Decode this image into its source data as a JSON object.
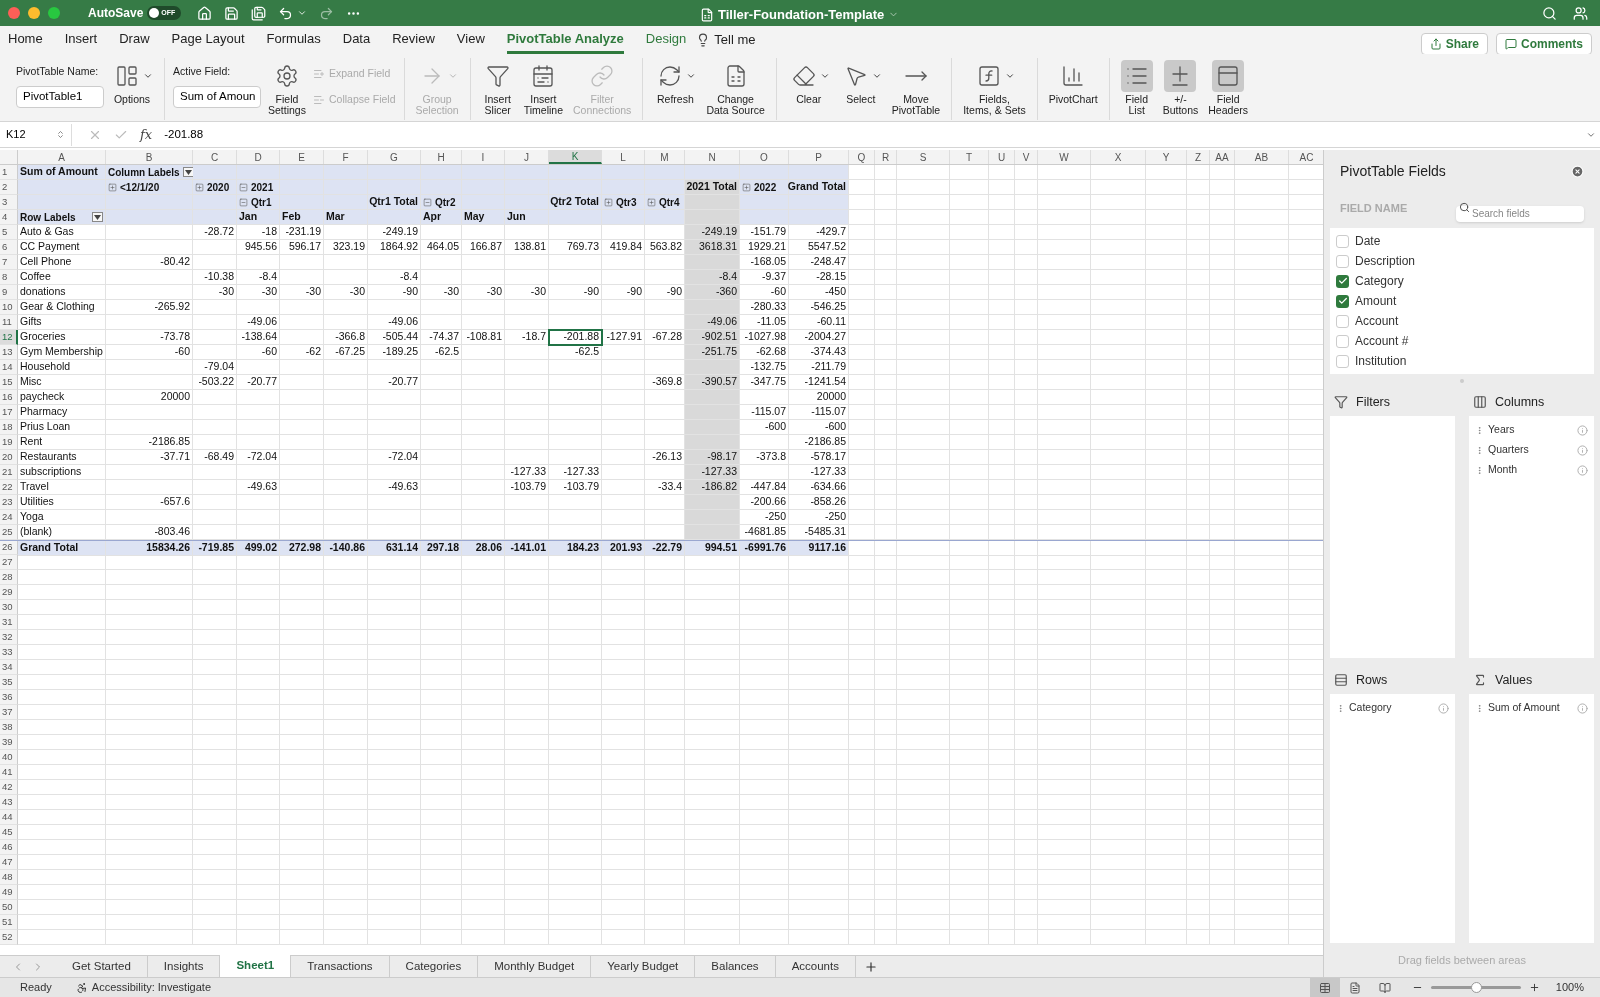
{
  "title_bar": {
    "autosave": {
      "label": "AutoSave",
      "on": false,
      "state_text": "OFF"
    },
    "title": "Tiller-Foundation-Template"
  },
  "tabs": [
    {
      "label": "Home",
      "selected": false,
      "kind": "standard"
    },
    {
      "label": "Insert",
      "selected": false,
      "kind": "standard"
    },
    {
      "label": "Draw",
      "selected": false,
      "kind": "standard"
    },
    {
      "label": "Page Layout",
      "selected": false,
      "kind": "standard"
    },
    {
      "label": "Formulas",
      "selected": false,
      "kind": "standard"
    },
    {
      "label": "Data",
      "selected": false,
      "kind": "standard"
    },
    {
      "label": "Review",
      "selected": false,
      "kind": "standard"
    },
    {
      "label": "View",
      "selected": false,
      "kind": "standard"
    },
    {
      "label": "PivotTable Analyze",
      "selected": true,
      "kind": "contextual"
    },
    {
      "label": "Design",
      "selected": false,
      "kind": "contextual"
    },
    {
      "label": "Tell me",
      "selected": false,
      "kind": "search"
    }
  ],
  "share_buttons": [
    "Share",
    "Comments"
  ],
  "ribbon": {
    "groups": [
      {
        "items": [
          {
            "kind": "name_field",
            "label": "PivotTable Name:",
            "value": "PivotTable1"
          },
          {
            "kind": "large",
            "label": "Options",
            "dropdown": true,
            "disabled": false,
            "pressed": false
          }
        ]
      },
      {
        "items": [
          {
            "kind": "name_field",
            "label": "Active Field:",
            "value": "Sum of Amoun"
          },
          {
            "kind": "large",
            "label": "Field\nSettings",
            "dropdown": false,
            "disabled": false,
            "pressed": false
          },
          {
            "kind": "small_stack",
            "buttons": [
              {
                "label": "Expand Field",
                "disabled": true
              },
              {
                "label": "Collapse Field",
                "disabled": true
              }
            ]
          }
        ]
      },
      {
        "items": [
          {
            "kind": "large",
            "label": "Group\nSelection",
            "dropdown": true,
            "disabled": true,
            "pressed": false
          }
        ]
      },
      {
        "items": [
          {
            "kind": "large",
            "label": "Insert\nSlicer",
            "dropdown": false,
            "disabled": false,
            "pressed": false
          },
          {
            "kind": "large",
            "label": "Insert\nTimeline",
            "dropdown": false,
            "disabled": false,
            "pressed": false
          },
          {
            "kind": "large",
            "label": "Filter\nConnections",
            "dropdown": false,
            "disabled": true,
            "pressed": false
          }
        ]
      },
      {
        "items": [
          {
            "kind": "large",
            "label": "Refresh",
            "dropdown": true,
            "disabled": false,
            "pressed": false
          },
          {
            "kind": "large",
            "label": "Change\nData Source",
            "dropdown": false,
            "disabled": false,
            "pressed": false
          }
        ]
      },
      {
        "items": [
          {
            "kind": "large",
            "label": "Clear",
            "dropdown": true,
            "disabled": false,
            "pressed": false
          },
          {
            "kind": "large",
            "label": "Select",
            "dropdown": true,
            "disabled": false,
            "pressed": false
          },
          {
            "kind": "large",
            "label": "Move\nPivotTable",
            "dropdown": false,
            "disabled": false,
            "pressed": false
          }
        ]
      },
      {
        "items": [
          {
            "kind": "large",
            "label": "Fields,\nItems, & Sets",
            "dropdown": true,
            "disabled": false,
            "pressed": false
          }
        ]
      },
      {
        "items": [
          {
            "kind": "large",
            "label": "PivotChart",
            "dropdown": false,
            "disabled": false,
            "pressed": false
          }
        ]
      },
      {
        "items": [
          {
            "kind": "large",
            "label": "Field\nList",
            "dropdown": false,
            "disabled": false,
            "pressed": true
          },
          {
            "kind": "large",
            "label": "+/-\nButtons",
            "dropdown": false,
            "disabled": false,
            "pressed": true
          },
          {
            "kind": "large",
            "label": "Field\nHeaders",
            "dropdown": false,
            "disabled": false,
            "pressed": true
          }
        ]
      }
    ]
  },
  "formula_bar": {
    "name_box": "K12",
    "function_label": "fx",
    "formula": "-201.88"
  },
  "sheet": {
    "columns": [
      {
        "label": "A",
        "selected": false
      },
      {
        "label": "B",
        "selected": false
      },
      {
        "label": "C",
        "selected": false
      },
      {
        "label": "D",
        "selected": false
      },
      {
        "label": "E",
        "selected": false
      },
      {
        "label": "F",
        "selected": false
      },
      {
        "label": "G",
        "selected": false
      },
      {
        "label": "H",
        "selected": false
      },
      {
        "label": "I",
        "selected": false
      },
      {
        "label": "J",
        "selected": false
      },
      {
        "label": "K",
        "selected": true
      },
      {
        "label": "L",
        "selected": false
      },
      {
        "label": "M",
        "selected": false
      },
      {
        "label": "N",
        "selected": false
      },
      {
        "label": "O",
        "selected": false
      },
      {
        "label": "P",
        "selected": false
      },
      {
        "label": "Q",
        "selected": false
      },
      {
        "label": "R",
        "selected": false
      },
      {
        "label": "S",
        "selected": false
      },
      {
        "label": "T",
        "selected": false
      },
      {
        "label": "U",
        "selected": false
      },
      {
        "label": "V",
        "selected": false
      },
      {
        "label": "W",
        "selected": false
      },
      {
        "label": "X",
        "selected": false
      },
      {
        "label": "Y",
        "selected": false
      },
      {
        "label": "Z",
        "selected": false
      },
      {
        "label": "AA",
        "selected": false
      },
      {
        "label": "AB",
        "selected": false
      },
      {
        "label": "AC",
        "selected": false
      }
    ],
    "rows": [
      {
        "label": "1",
        "selected": false
      },
      {
        "label": "2",
        "selected": false
      },
      {
        "label": "3",
        "selected": false
      },
      {
        "label": "4",
        "selected": false
      },
      {
        "label": "5",
        "selected": false
      },
      {
        "label": "6",
        "selected": false
      },
      {
        "label": "7",
        "selected": false
      },
      {
        "label": "8",
        "selected": false
      },
      {
        "label": "9",
        "selected": false
      },
      {
        "label": "10",
        "selected": false
      },
      {
        "label": "11",
        "selected": false
      },
      {
        "label": "12",
        "selected": true
      },
      {
        "label": "13",
        "selected": false
      },
      {
        "label": "14",
        "selected": false
      },
      {
        "label": "15",
        "selected": false
      },
      {
        "label": "16",
        "selected": false
      },
      {
        "label": "17",
        "selected": false
      },
      {
        "label": "18",
        "selected": false
      },
      {
        "label": "19",
        "selected": false
      },
      {
        "label": "20",
        "selected": false
      },
      {
        "label": "21",
        "selected": false
      },
      {
        "label": "22",
        "selected": false
      },
      {
        "label": "23",
        "selected": false
      },
      {
        "label": "24",
        "selected": false
      },
      {
        "label": "25",
        "selected": false
      },
      {
        "label": "26",
        "selected": false
      },
      {
        "label": "27",
        "selected": false
      },
      {
        "label": "28",
        "selected": false
      },
      {
        "label": "29",
        "selected": false
      },
      {
        "label": "30",
        "selected": false
      },
      {
        "label": "31",
        "selected": false
      },
      {
        "label": "32",
        "selected": false
      },
      {
        "label": "33",
        "selected": false
      },
      {
        "label": "34",
        "selected": false
      },
      {
        "label": "35",
        "selected": false
      },
      {
        "label": "36",
        "selected": false
      },
      {
        "label": "37",
        "selected": false
      },
      {
        "label": "38",
        "selected": false
      },
      {
        "label": "39",
        "selected": false
      },
      {
        "label": "40",
        "selected": false
      },
      {
        "label": "41",
        "selected": false
      },
      {
        "label": "42",
        "selected": false
      },
      {
        "label": "43",
        "selected": false
      },
      {
        "label": "44",
        "selected": false
      },
      {
        "label": "45",
        "selected": false
      },
      {
        "label": "46",
        "selected": false
      },
      {
        "label": "47",
        "selected": false
      },
      {
        "label": "48",
        "selected": false
      },
      {
        "label": "49",
        "selected": false
      },
      {
        "label": "50",
        "selected": false
      },
      {
        "label": "51",
        "selected": false
      },
      {
        "label": "52",
        "selected": false
      }
    ],
    "pivot": {
      "header_rows": [
        {
          "a": {
            "text": "Sum of Amount",
            "kind": "label"
          },
          "b": {
            "text": "Column Labels",
            "kind": "label",
            "filter": true
          }
        },
        {
          "b": {
            "text": "<12/1/20",
            "kind": "label",
            "expanded": false
          },
          "c": {
            "text": "2020",
            "kind": "label",
            "expanded": false
          },
          "d": {
            "text": "2021",
            "kind": "label",
            "expanded": true
          },
          "n": {
            "text": "2021 Total",
            "kind": "total"
          },
          "o": {
            "text": "2022",
            "kind": "label",
            "expanded": false
          },
          "p": {
            "text": "Grand Total",
            "kind": "total"
          }
        },
        {
          "d": {
            "text": "Qtr1",
            "kind": "label",
            "expanded": true
          },
          "g": {
            "text": "Qtr1 Total",
            "kind": "total"
          },
          "h": {
            "text": "Qtr2",
            "kind": "label",
            "expanded": true
          },
          "k": {
            "text": "Qtr2 Total",
            "kind": "total"
          },
          "l": {
            "text": "Qtr3",
            "kind": "label",
            "expanded": false
          },
          "m": {
            "text": "Qtr4",
            "kind": "label",
            "expanded": false
          }
        },
        {
          "a": {
            "text": "Row Labels",
            "kind": "label",
            "filter": true
          },
          "d": {
            "text": "Jan",
            "kind": "label"
          },
          "e": {
            "text": "Feb",
            "kind": "label"
          },
          "f": {
            "text": "Mar",
            "kind": "label"
          },
          "h": {
            "text": "Apr",
            "kind": "label"
          },
          "i": {
            "text": "May",
            "kind": "label"
          },
          "j": {
            "text": "Jun",
            "kind": "label"
          }
        }
      ],
      "body_rows": [
        {
          "label": "Auto & Gas",
          "values": {
            "c": "-28.72",
            "d": "-18",
            "e": "-231.19",
            "g": "-249.19",
            "n": "-249.19",
            "o": "-151.79",
            "p": "-429.7"
          }
        },
        {
          "label": "CC Payment",
          "values": {
            "d": "945.56",
            "e": "596.17",
            "f": "323.19",
            "g": "1864.92",
            "h": "464.05",
            "i": "166.87",
            "j": "138.81",
            "k": "769.73",
            "l": "419.84",
            "m": "563.82",
            "n": "3618.31",
            "o": "1929.21",
            "p": "5547.52"
          }
        },
        {
          "label": "Cell Phone",
          "values": {
            "b": "-80.42",
            "o": "-168.05",
            "p": "-248.47"
          }
        },
        {
          "label": "Coffee",
          "values": {
            "c": "-10.38",
            "d": "-8.4",
            "g": "-8.4",
            "n": "-8.4",
            "o": "-9.37",
            "p": "-28.15"
          }
        },
        {
          "label": "donations",
          "values": {
            "c": "-30",
            "d": "-30",
            "e": "-30",
            "f": "-30",
            "g": "-90",
            "h": "-30",
            "i": "-30",
            "j": "-30",
            "k": "-90",
            "l": "-90",
            "m": "-90",
            "n": "-360",
            "o": "-60",
            "p": "-450"
          }
        },
        {
          "label": "Gear & Clothing",
          "values": {
            "b": "-265.92",
            "o": "-280.33",
            "p": "-546.25"
          }
        },
        {
          "label": "Gifts",
          "values": {
            "d": "-49.06",
            "g": "-49.06",
            "n": "-49.06",
            "o": "-11.05",
            "p": "-60.11"
          }
        },
        {
          "label": "Groceries",
          "values": {
            "b": "-73.78",
            "d": "-138.64",
            "f": "-366.8",
            "g": "-505.44",
            "h": "-74.37",
            "i": "-108.81",
            "j": "-18.7",
            "k": "-201.88",
            "l": "-127.91",
            "m": "-67.28",
            "n": "-902.51",
            "o": "-1027.98",
            "p": "-2004.27"
          }
        },
        {
          "label": "Gym Membership",
          "values": {
            "b": "-60",
            "d": "-60",
            "e": "-62",
            "f": "-67.25",
            "g": "-189.25",
            "h": "-62.5",
            "k": "-62.5",
            "n": "-251.75",
            "o": "-62.68",
            "p": "-374.43"
          }
        },
        {
          "label": "Household",
          "values": {
            "c": "-79.04",
            "o": "-132.75",
            "p": "-211.79"
          }
        },
        {
          "label": "Misc",
          "values": {
            "c": "-503.22",
            "d": "-20.77",
            "g": "-20.77",
            "m": "-369.8",
            "n": "-390.57",
            "o": "-347.75",
            "p": "-1241.54"
          }
        },
        {
          "label": "paycheck",
          "values": {
            "b": "20000",
            "p": "20000"
          }
        },
        {
          "label": "Pharmacy",
          "values": {
            "o": "-115.07",
            "p": "-115.07"
          }
        },
        {
          "label": "Prius Loan",
          "values": {
            "o": "-600",
            "p": "-600"
          }
        },
        {
          "label": "Rent",
          "values": {
            "b": "-2186.85",
            "p": "-2186.85"
          }
        },
        {
          "label": "Restaurants",
          "values": {
            "b": "-37.71",
            "c": "-68.49",
            "d": "-72.04",
            "g": "-72.04",
            "m": "-26.13",
            "n": "-98.17",
            "o": "-373.8",
            "p": "-578.17"
          }
        },
        {
          "label": "subscriptions",
          "values": {
            "j": "-127.33",
            "k": "-127.33",
            "n": "-127.33",
            "p": "-127.33"
          }
        },
        {
          "label": "Travel",
          "values": {
            "d": "-49.63",
            "g": "-49.63",
            "j": "-103.79",
            "k": "-103.79",
            "m": "-33.4",
            "n": "-186.82",
            "o": "-447.84",
            "p": "-634.66"
          }
        },
        {
          "label": "Utilities",
          "values": {
            "b": "-657.6",
            "o": "-200.66",
            "p": "-858.26"
          }
        },
        {
          "label": "Yoga",
          "values": {
            "o": "-250",
            "p": "-250"
          }
        },
        {
          "label": "(blank)",
          "values": {
            "b": "-803.46",
            "o": "-4681.85",
            "p": "-5485.31"
          }
        }
      ],
      "grand_total": {
        "label": "Grand Total",
        "values": {
          "b": "15834.26",
          "c": "-719.85",
          "d": "499.02",
          "e": "272.98",
          "f": "-140.86",
          "g": "631.14",
          "h": "297.18",
          "i": "28.06",
          "j": "-141.01",
          "k": "184.23",
          "l": "201.93",
          "m": "-22.79",
          "n": "994.51",
          "o": "-6991.76",
          "p": "9117.16"
        }
      }
    }
  },
  "sheet_tabs": [
    {
      "label": "Get Started",
      "selected": false
    },
    {
      "label": "Insights",
      "selected": false
    },
    {
      "label": "Sheet1",
      "selected": true
    },
    {
      "label": "Transactions",
      "selected": false
    },
    {
      "label": "Categories",
      "selected": false
    },
    {
      "label": "Monthly Budget",
      "selected": false
    },
    {
      "label": "Yearly Budget",
      "selected": false
    },
    {
      "label": "Balances",
      "selected": false
    },
    {
      "label": "Accounts",
      "selected": false
    }
  ],
  "field_panel": {
    "title": "PivotTable Fields",
    "field_name_label": "FIELD NAME",
    "search_placeholder": "Search fields",
    "fields": [
      {
        "label": "Date",
        "checked": false
      },
      {
        "label": "Description",
        "checked": false
      },
      {
        "label": "Category",
        "checked": true
      },
      {
        "label": "Amount",
        "checked": true
      },
      {
        "label": "Account",
        "checked": false
      },
      {
        "label": "Account #",
        "checked": false
      },
      {
        "label": "Institution",
        "checked": false
      }
    ],
    "areas": [
      {
        "kind": "filters",
        "title": "Filters"
      },
      {
        "kind": "columns",
        "title": "Columns",
        "items": [
          "Years",
          "Quarters",
          "Month"
        ]
      },
      {
        "kind": "rows",
        "title": "Rows",
        "items": [
          "Category"
        ]
      },
      {
        "kind": "values",
        "title": "Values",
        "items": [
          "Sum of Amount"
        ]
      }
    ],
    "hint": "Drag fields between areas"
  },
  "status_bar": {
    "status": "Ready",
    "accessibility": "Accessibility: Investigate",
    "views": [
      {
        "selected": true
      },
      {
        "selected": false
      },
      {
        "selected": false
      }
    ],
    "zoom": {
      "level": 0.5,
      "reading": "100%"
    }
  }
}
